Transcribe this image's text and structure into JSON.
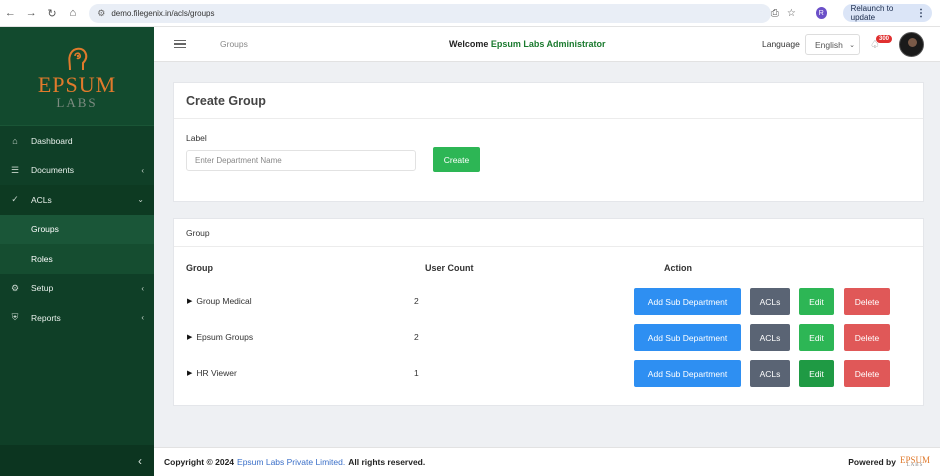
{
  "browser": {
    "url": "demo.filegenix.in/acls/groups",
    "profile_initial": "R",
    "relaunch_label": "Relaunch to update"
  },
  "sidebar": {
    "logo_text": "EPSUM",
    "logo_sub": "LABS",
    "items": [
      {
        "label": "Dashboard",
        "icon": "home-icon"
      },
      {
        "label": "Documents",
        "icon": "layers-icon"
      },
      {
        "label": "ACLs",
        "icon": "check-circle-icon"
      },
      {
        "label": "Setup",
        "icon": "gear-icon"
      },
      {
        "label": "Reports",
        "icon": "shield-icon"
      }
    ],
    "acl_subitems": [
      {
        "label": "Groups"
      },
      {
        "label": "Roles"
      }
    ]
  },
  "header": {
    "breadcrumb": "Groups",
    "welcome_prefix": "Welcome",
    "welcome_org": "Epsum Labs Administrator",
    "language_label": "Language",
    "language_value": "English",
    "notification_count": "300"
  },
  "create_group": {
    "title": "Create Group",
    "label": "Label",
    "placeholder": "Enter Department Name",
    "button": "Create"
  },
  "group_table": {
    "card_title": "Group",
    "columns": [
      "Group",
      "User Count",
      "Action"
    ],
    "rows": [
      {
        "name": "Group Medical",
        "count": "2"
      },
      {
        "name": "Epsum Groups",
        "count": "2"
      },
      {
        "name": "HR Viewer",
        "count": "1"
      }
    ],
    "actions": {
      "add_sub": "Add Sub Department",
      "acls": "ACLs",
      "edit": "Edit",
      "delete": "Delete"
    }
  },
  "footer": {
    "copyright_prefix": "Copyright © 2024",
    "company": "Epsum Labs Private Limited.",
    "rights": "All rights reserved.",
    "powered_by": "Powered by",
    "powered_logo": "EPSUM",
    "powered_logo_sub": "LABS"
  },
  "colors": {
    "sidebar_bg": "#0f3f27",
    "accent_green": "#2db655",
    "primary_blue": "#2e8ff2",
    "danger_red": "#e05858",
    "secondary_gray": "#5a6474",
    "logo_orange": "#e07a2c"
  }
}
